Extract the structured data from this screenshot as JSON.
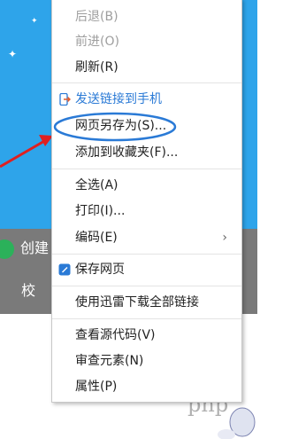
{
  "background": {
    "band_text_1": "创建",
    "band_text_2": "校",
    "watermark": "php"
  },
  "menu": {
    "items": [
      {
        "label": "后退(B)"
      },
      {
        "label": "前进(O)"
      },
      {
        "label": "刷新(R)"
      },
      {
        "label": "发送链接到手机"
      },
      {
        "label": "网页另存为(S)..."
      },
      {
        "label": "添加到收藏夹(F)..."
      },
      {
        "label": "全选(A)"
      },
      {
        "label": "打印(I)..."
      },
      {
        "label": "编码(E)"
      },
      {
        "label": "保存网页"
      },
      {
        "label": "使用迅雷下载全部链接"
      },
      {
        "label": "查看源代码(V)"
      },
      {
        "label": "审查元素(N)"
      },
      {
        "label": "属性(P)"
      }
    ]
  },
  "colors": {
    "page_blue": "#2ea4ea",
    "annotation_red": "#e02020",
    "highlight_ellipse": "#2a7ad6",
    "link_blue": "#2a7ad6"
  }
}
